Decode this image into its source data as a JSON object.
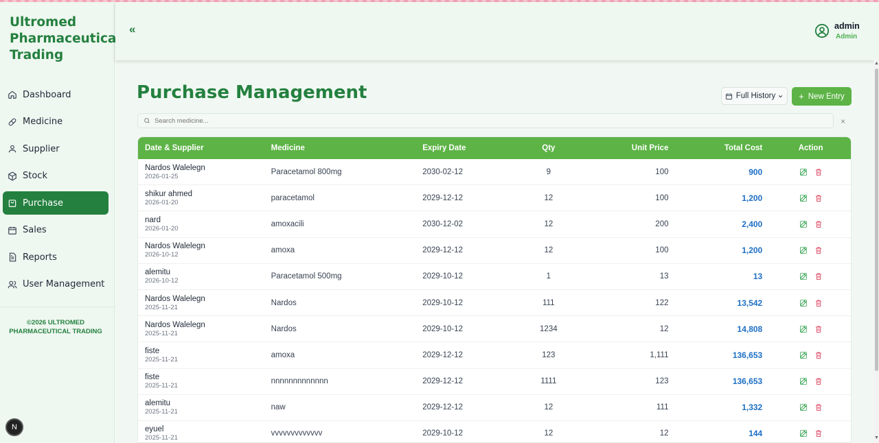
{
  "sidebar": {
    "brand": "Ultromed Pharmaceutical Trading",
    "items": [
      {
        "label": "Dashboard",
        "icon": "home-icon"
      },
      {
        "label": "Medicine",
        "icon": "pill-icon"
      },
      {
        "label": "Supplier",
        "icon": "user-icon"
      },
      {
        "label": "Stock",
        "icon": "box-icon"
      },
      {
        "label": "Purchase",
        "icon": "bag-icon"
      },
      {
        "label": "Sales",
        "icon": "calendar-icon"
      },
      {
        "label": "Reports",
        "icon": "document-icon"
      },
      {
        "label": "User Management",
        "icon": "users-icon"
      }
    ],
    "active": "Purchase",
    "footer": "©2026 ULTROMED PHARMACEUTICAL TRADING",
    "badge": "N"
  },
  "header": {
    "collapse": "«",
    "user_name": "admin",
    "user_role": "Admin"
  },
  "page": {
    "title": "Purchase Management",
    "history_label": "Full History",
    "new_entry_label": "New Entry",
    "search_placeholder": "Search medicine...",
    "clear": "×"
  },
  "table": {
    "headers": [
      "Date & Supplier",
      "Medicine",
      "Expiry Date",
      "Qty",
      "Unit Price",
      "Total Cost",
      "Action"
    ],
    "rows": [
      {
        "supplier": "Nardos Walelegn",
        "date": "2026-01-25",
        "medicine": "Paracetamol 800mg",
        "expiry": "2030-02-12",
        "qty": "9",
        "unit": "100",
        "total": "900"
      },
      {
        "supplier": "shikur ahmed",
        "date": "2026-01-20",
        "medicine": "paracetamol",
        "expiry": "2029-12-12",
        "qty": "12",
        "unit": "100",
        "total": "1,200"
      },
      {
        "supplier": "nard",
        "date": "2026-01-20",
        "medicine": "amoxacili",
        "expiry": "2030-12-02",
        "qty": "12",
        "unit": "200",
        "total": "2,400"
      },
      {
        "supplier": "Nardos Walelegn",
        "date": "2026-10-12",
        "medicine": "amoxa",
        "expiry": "2029-12-12",
        "qty": "12",
        "unit": "100",
        "total": "1,200"
      },
      {
        "supplier": "alemitu",
        "date": "2026-10-12",
        "medicine": "Paracetamol 500mg",
        "expiry": "2029-10-12",
        "qty": "1",
        "unit": "13",
        "total": "13"
      },
      {
        "supplier": "Nardos Walelegn",
        "date": "2025-11-21",
        "medicine": "Nardos",
        "expiry": "2029-10-12",
        "qty": "111",
        "unit": "122",
        "total": "13,542"
      },
      {
        "supplier": "Nardos Walelegn",
        "date": "2025-11-21",
        "medicine": "Nardos",
        "expiry": "2029-10-12",
        "qty": "1234",
        "unit": "12",
        "total": "14,808"
      },
      {
        "supplier": "fiste",
        "date": "2025-11-21",
        "medicine": "amoxa",
        "expiry": "2029-12-12",
        "qty": "123",
        "unit": "1,111",
        "total": "136,653"
      },
      {
        "supplier": "fiste",
        "date": "2025-11-21",
        "medicine": "nnnnnnnnnnnnn",
        "expiry": "2029-12-12",
        "qty": "1111",
        "unit": "123",
        "total": "136,653"
      },
      {
        "supplier": "alemitu",
        "date": "2025-11-21",
        "medicine": "naw",
        "expiry": "2029-12-12",
        "qty": "12",
        "unit": "111",
        "total": "1,332"
      },
      {
        "supplier": "eyuel",
        "date": "2025-11-21",
        "medicine": "vvvvvvvvvvvvv",
        "expiry": "2029-10-12",
        "qty": "12",
        "unit": "12",
        "total": "144"
      }
    ]
  },
  "colors": {
    "brand_green": "#24803f",
    "button_green": "#5db346",
    "total_blue": "#1d6fc4",
    "edit_green": "#3aa655",
    "delete_red": "#e0566f"
  }
}
